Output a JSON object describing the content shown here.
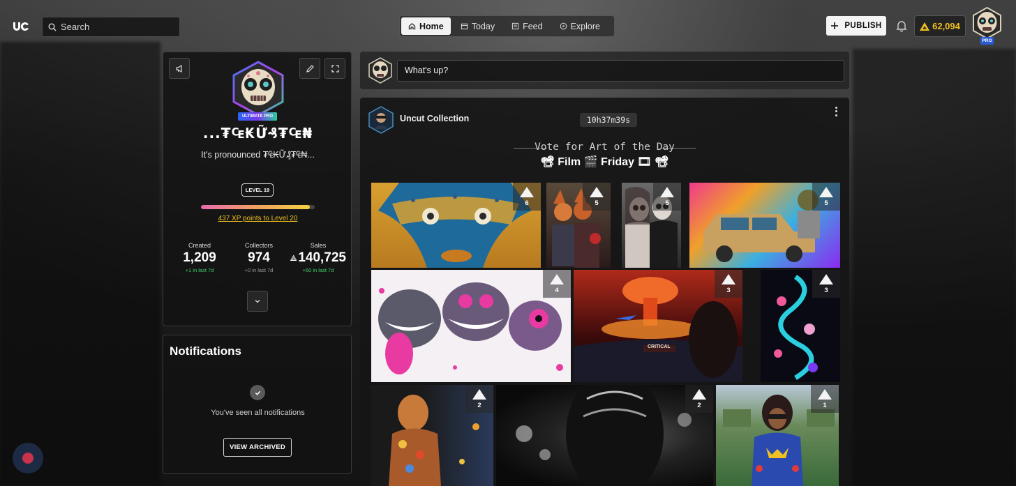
{
  "app": {
    "logo": "UC"
  },
  "search": {
    "placeholder": "Search"
  },
  "nav": {
    "items": [
      {
        "label": "Home",
        "icon": "home-icon",
        "active": true
      },
      {
        "label": "Today",
        "icon": "calendar-icon",
        "active": false
      },
      {
        "label": "Feed",
        "icon": "feed-icon",
        "active": false
      },
      {
        "label": "Explore",
        "icon": "compass-icon",
        "active": false
      }
    ]
  },
  "header": {
    "publish_label": "PUBLISH",
    "credits": "62,094",
    "pro_label": "PRO"
  },
  "profile": {
    "badge": "ULTIMATE PRO",
    "username": "...₮₠₭Ữ₰₮₠₦",
    "bio": "It's pronounced ₮₠₭Ữ₰₮₠₦...",
    "level": "LEVEL 19",
    "xp_progress": 0.96,
    "xp_text": "437 XP points to Level 20",
    "stats": [
      {
        "label": "Created",
        "value": "1,209",
        "delta": "+1 in last 7d",
        "delta_color": "green"
      },
      {
        "label": "Collectors",
        "value": "974",
        "delta": "+0 in last 7d",
        "delta_color": "gray"
      },
      {
        "label": "Sales",
        "value": "140,725",
        "delta": "+60 in last 7d",
        "delta_color": "green",
        "icon": "credits-icon"
      }
    ]
  },
  "notifications": {
    "title": "Notifications",
    "empty_text": "You've seen all notifications",
    "view_archived_label": "VIEW ARCHIVED"
  },
  "composer": {
    "placeholder": "What's up?"
  },
  "post": {
    "collection_name": "Uncut Collection",
    "timer": "10h37m39s",
    "heading": "Vote for Art of the Day",
    "subheading": "📽 Film 🎬 Friday 🎞 📽",
    "tiles": [
      {
        "votes": "6",
        "subject": "blue-masked-face"
      },
      {
        "votes": "5",
        "subject": "fox-warriors"
      },
      {
        "votes": "5",
        "subject": "skull-painted-women"
      },
      {
        "votes": "5",
        "subject": "psychedelic-car"
      },
      {
        "votes": "4",
        "subject": "pink-monsters"
      },
      {
        "votes": "3",
        "subject": "mushroom-cloud-cockpit"
      },
      {
        "votes": "3",
        "subject": "neon-serpent-flowers"
      },
      {
        "votes": "2",
        "subject": "butterfly-figure"
      },
      {
        "votes": "2",
        "subject": "chrome-alien"
      },
      {
        "votes": "1",
        "subject": "wonder-woman-garden"
      }
    ]
  },
  "colors": {
    "accent_gold": "#f0c020",
    "delta_green": "#3ed06a",
    "pro_blue": "#2a5bd7",
    "record_red": "#c8324a"
  }
}
